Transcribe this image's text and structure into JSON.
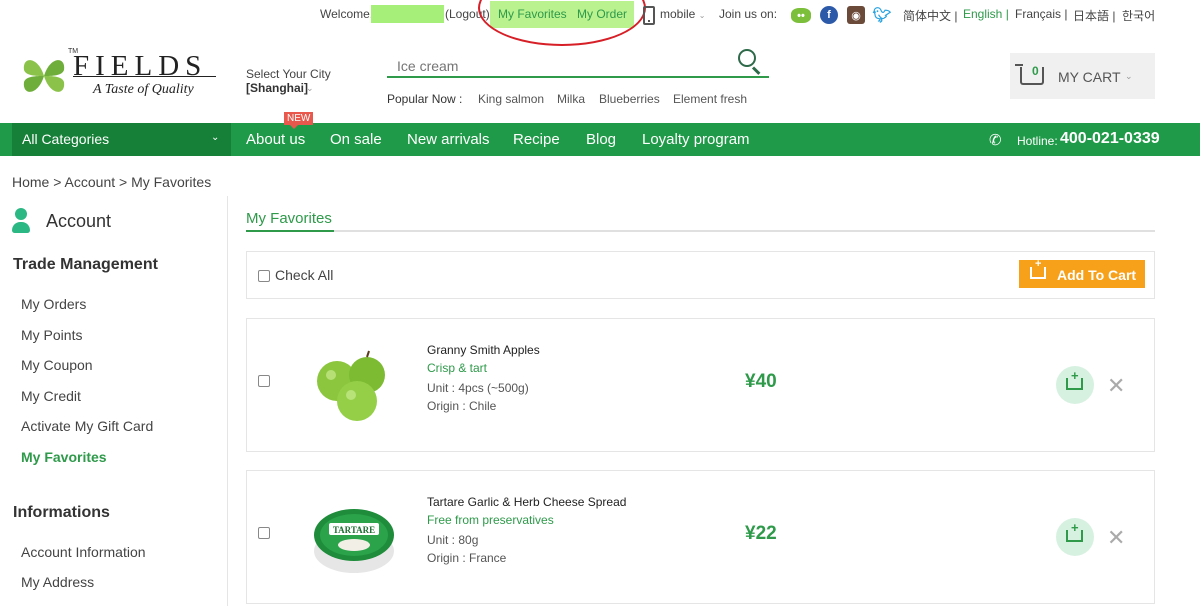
{
  "topbar": {
    "welcome": "Welcome,",
    "logout": "(Logout)",
    "my_favorites": "My Favorites",
    "my_order": "My Order",
    "mobile": "mobile",
    "join_us": "Join us on:",
    "languages": [
      "简体中文 |",
      "English |",
      "Français |",
      "日本語 |",
      "한국어"
    ]
  },
  "logo": {
    "name": "FIELDS",
    "tm": "TM",
    "tagline": "A Taste of Quality"
  },
  "city": {
    "label": "Select Your City",
    "value": "[Shanghai]"
  },
  "search": {
    "placeholder": "Ice cream",
    "popular_label": "Popular Now :",
    "popular": [
      "King salmon",
      "Milka",
      "Blueberries",
      "Element fresh"
    ]
  },
  "cart": {
    "count": "0",
    "label": "MY CART"
  },
  "nav": {
    "all_categories": "All Categories",
    "items": [
      "About us",
      "On sale",
      "New arrivals",
      "Recipe",
      "Blog",
      "Loyalty program"
    ],
    "new_badge": "NEW",
    "hotline_label": "Hotline:",
    "hotline_number": "400-021-0339"
  },
  "breadcrumb": "Home > Account > My Favorites",
  "sidebar": {
    "title": "Account",
    "section1": "Trade Management",
    "links1": [
      "My Orders",
      "My Points",
      "My Coupon",
      "My Credit",
      "Activate My Gift Card",
      "My Favorites"
    ],
    "section2": "Informations",
    "links2": [
      "Account Information",
      "My Address"
    ]
  },
  "main": {
    "tab": "My Favorites",
    "check_all": "Check All",
    "add_to_cart": "Add To Cart",
    "products": [
      {
        "name": "Granny Smith Apples",
        "tag": "Crisp & tart",
        "unit": "Unit : 4pcs (~500g)",
        "origin": "Origin : Chile",
        "price": "¥40"
      },
      {
        "name": "Tartare Garlic & Herb Cheese Spread",
        "tag": "Free from preservatives",
        "unit": "Unit : 80g",
        "origin": "Origin : France",
        "price": "¥22"
      }
    ],
    "cheese_lid_text": "TARTARE"
  },
  "colors": {
    "brand_green": "#1f9a48",
    "accent_orange": "#f7a11b",
    "highlight": "#b9f28f",
    "annotation_red": "#d61f26"
  }
}
